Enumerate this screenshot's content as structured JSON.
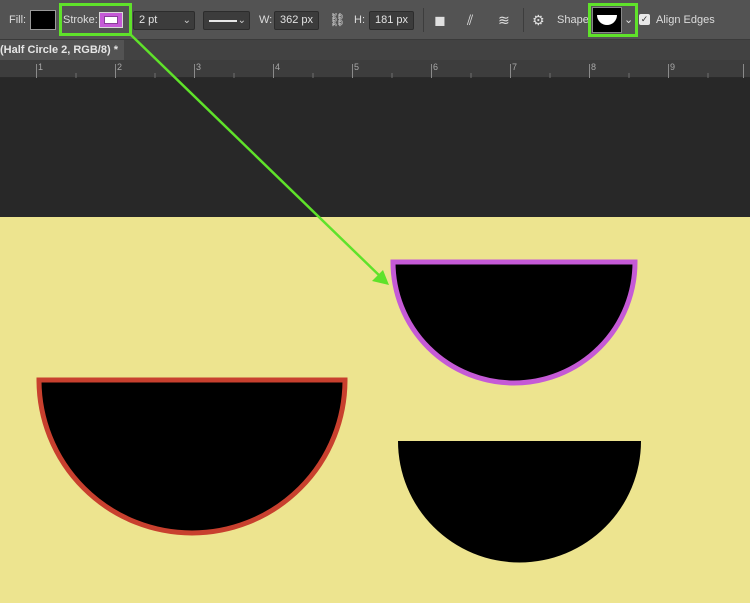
{
  "options_bar": {
    "fill_label": "Fill:",
    "stroke_label": "Stroke:",
    "stroke_width": "2 pt",
    "width_label": "W:",
    "width_value": "362 px",
    "height_label": "H:",
    "height_value": "181 px",
    "shape_label": "Shape",
    "align_edges_label": "Align Edges",
    "colors": {
      "fill": "#000000",
      "stroke": "#c55ad6",
      "highlight": "#5fe22a"
    }
  },
  "document_tab": {
    "title": "(Half Circle 2, RGB/8) *"
  },
  "ruler": {
    "ticks": [
      "1",
      "2",
      "3",
      "4",
      "5",
      "6",
      "7",
      "8",
      "9"
    ]
  },
  "canvas": {
    "background": "#ede48f",
    "shapes": [
      {
        "name": "half-circle-red-stroke",
        "fill": "#000000",
        "stroke": "#c8402e"
      },
      {
        "name": "half-circle-purple-stroke",
        "fill": "#000000",
        "stroke": "#c55ad6"
      },
      {
        "name": "half-circle-no-stroke",
        "fill": "#000000",
        "stroke": "none"
      }
    ]
  }
}
